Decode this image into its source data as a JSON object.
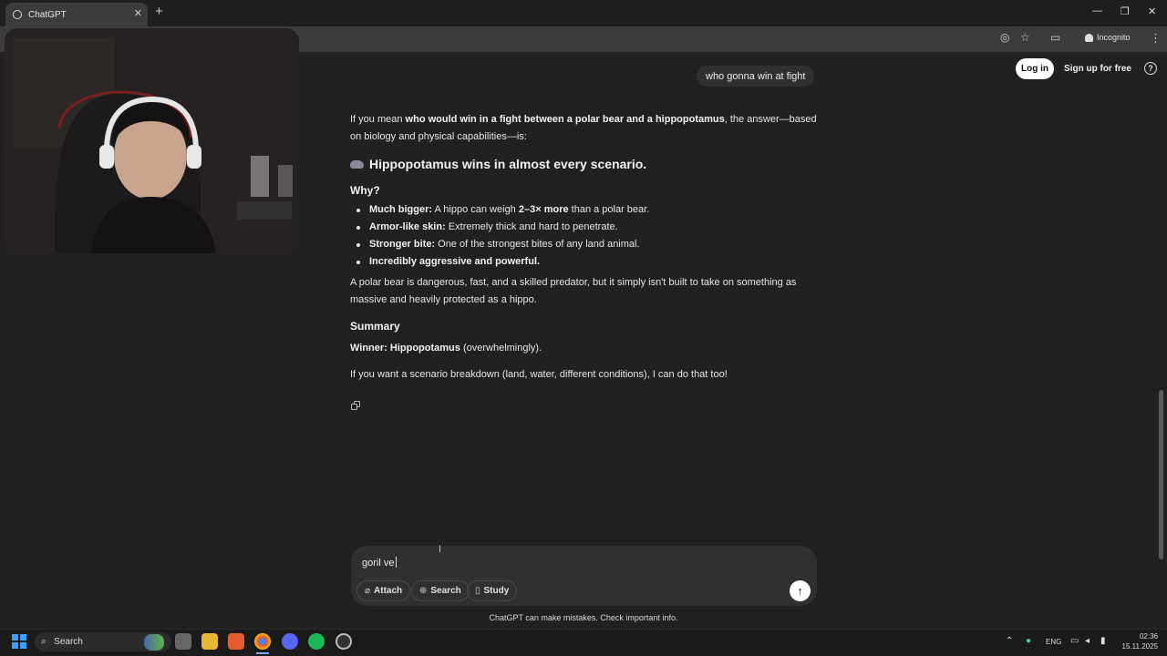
{
  "browser": {
    "tab_title": "ChatGPT",
    "tab_close": "✕",
    "new_tab": "+",
    "back": "←",
    "incognito_label": "Incognito",
    "window_controls": [
      "—",
      "❐",
      "✕"
    ]
  },
  "header": {
    "login_label": "Log in",
    "signup_label": "Sign up for free",
    "help_label": "?"
  },
  "chat": {
    "user_message": "who gonna win at fight",
    "intro_pre": "If you mean ",
    "intro_bold": "who would win in a fight between a polar bear and a hippopotamus",
    "intro_post": ", the answer—based on biology and physical capabilities—is:",
    "headline": "Hippopotamus wins in almost every scenario.",
    "why_heading": "Why?",
    "reasons": [
      {
        "bold": "Much bigger:",
        "pre": " A hippo can weigh ",
        "bold2": "2–3× more",
        "post": " than a polar bear."
      },
      {
        "bold": "Armor-like skin:",
        "pre": " Extremely thick and hard to penetrate.",
        "bold2": "",
        "post": ""
      },
      {
        "bold": "Stronger bite:",
        "pre": " One of the strongest bites of any land animal.",
        "bold2": "",
        "post": ""
      },
      {
        "bold": "Incredibly aggressive and powerful.",
        "pre": "",
        "bold2": "",
        "post": ""
      }
    ],
    "paragraph2": "A polar bear is dangerous, fast, and a skilled predator, but it simply isn't built to take on something as massive and heavily protected as a hippo.",
    "summary_heading": "Summary",
    "winner_bold": "Winner: Hippopotamus",
    "winner_post": " (overwhelmingly).",
    "closing": "If you want a scenario breakdown (land, water, different conditions), I can do that too!"
  },
  "composer": {
    "value": "goril ve",
    "attach_label": "Attach",
    "search_label": "Search",
    "study_label": "Study",
    "send_icon": "↑"
  },
  "disclaimer": "ChatGPT can make mistakes. Check important info.",
  "taskbar": {
    "search_label": "Search",
    "language": "ENG",
    "time": "02:36",
    "date": "15.11.2025"
  },
  "colors": {
    "background": "#212121",
    "bubble": "#303030",
    "accent": "#3aa0ff"
  }
}
